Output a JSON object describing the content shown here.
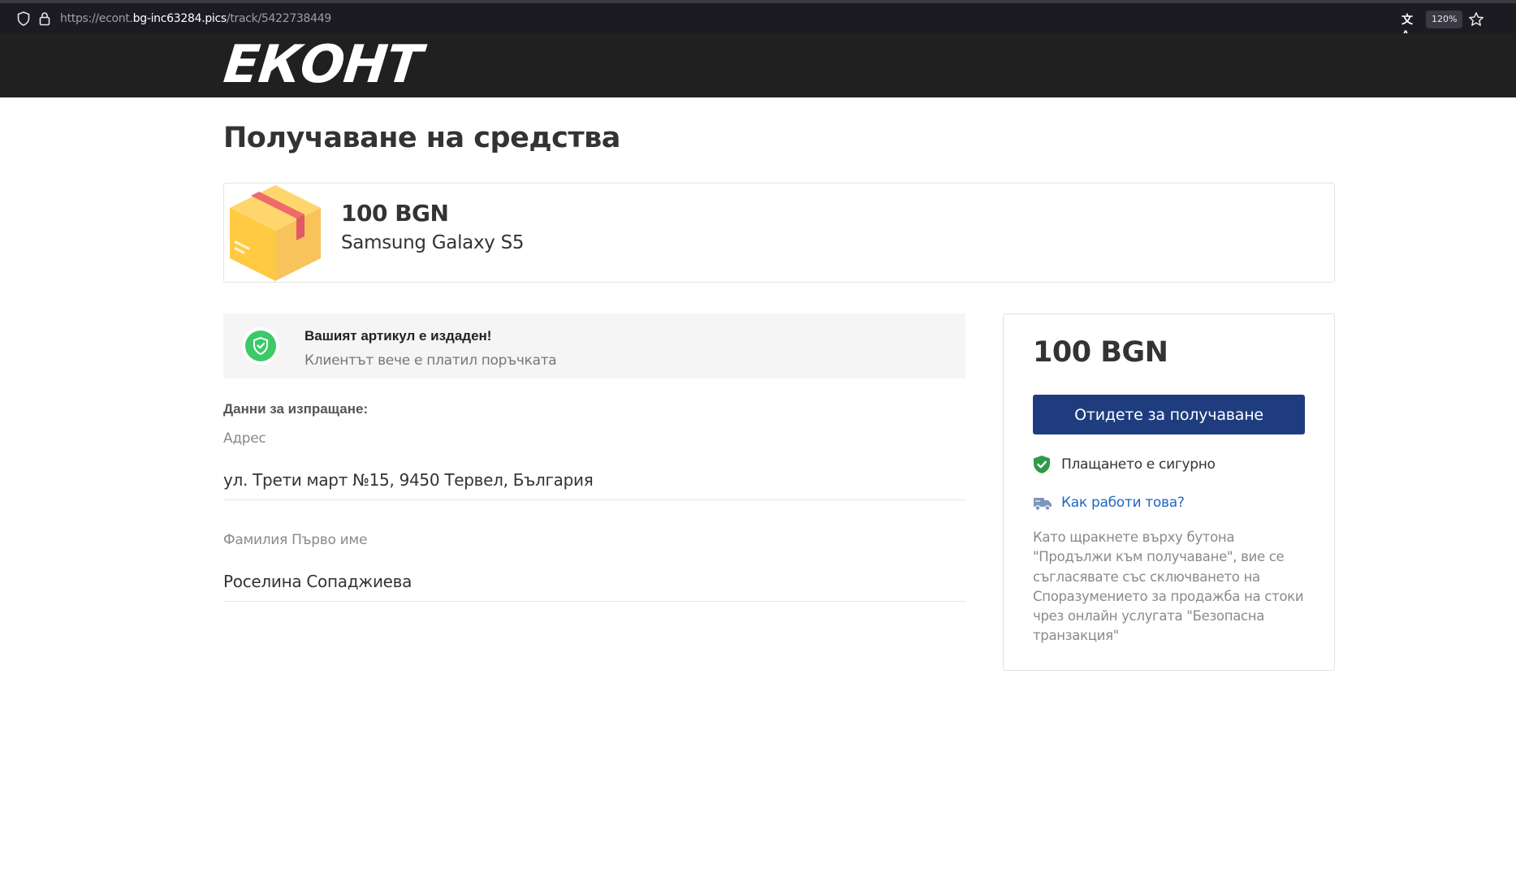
{
  "browser": {
    "url_prefix": "https://econt.",
    "url_host": "bg-inc63284.pics",
    "url_path": "/track/5422738449",
    "zoom": "120%",
    "translate_glyph": "文A"
  },
  "header": {
    "logo_text": "ЕКОНТ"
  },
  "page": {
    "title": "Получаване на средства"
  },
  "product": {
    "price": "100 BGN",
    "name": "Samsung Galaxy S5"
  },
  "notice": {
    "title": "Вашият артикул е издаден!",
    "subtitle": "Клиентът вече е платил поръчката"
  },
  "shipping": {
    "heading": "Данни за изпращане:",
    "address_label": "Адрес",
    "address_value": "ул. Трети март №15, 9450 Тервел, България",
    "name_label": "Фамилия Първо име",
    "name_value": "Роселина Сопаджиева"
  },
  "payment": {
    "amount": "100 BGN",
    "button_label": "Отидете за получаване",
    "secure_text": "Плащането е сигурно",
    "how_link": "Как работи това?",
    "terms": "Като щракнете върху бутона \"Продължи към получаване\", вие се съгласявате със сключването на Споразумението за продажба на стоки чрез онлайн услугата \"Безопасна транзакция\""
  },
  "colors": {
    "header_bg": "#202020",
    "button_bg": "#1f3d7e",
    "link": "#1f66c2",
    "success_green": "#3cc96a",
    "secure_green": "#2e9b48"
  },
  "icons": [
    "shield-icon",
    "lock-icon",
    "translate-icon",
    "star-icon",
    "package-box-icon",
    "shield-check-icon",
    "secure-shield-icon",
    "truck-icon"
  ]
}
